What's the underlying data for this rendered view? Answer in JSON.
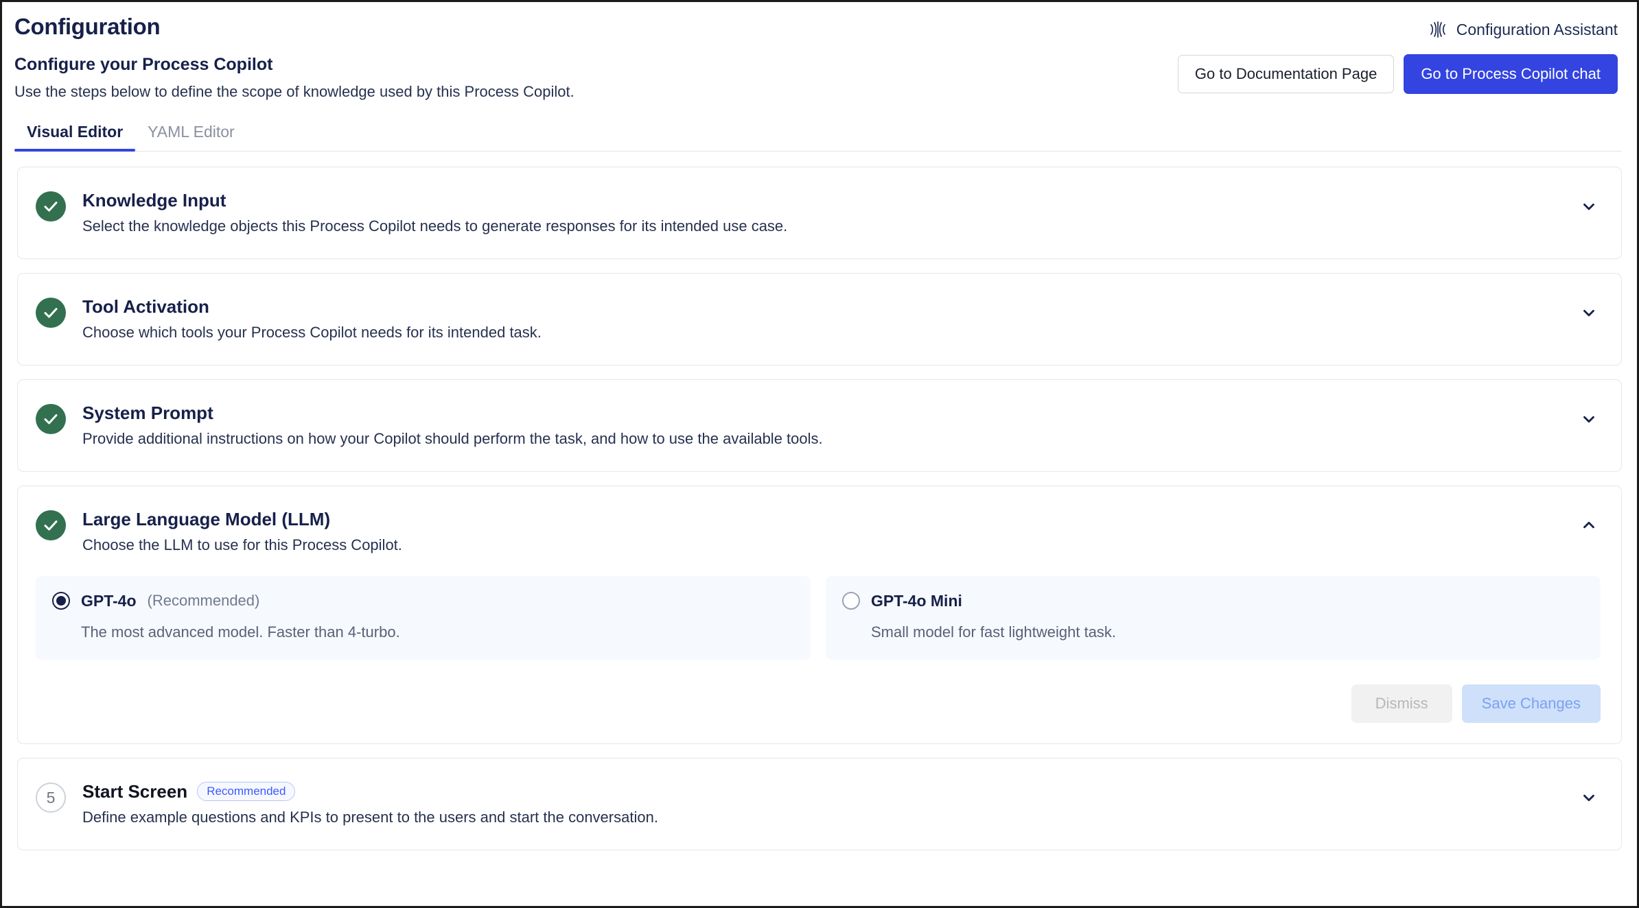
{
  "header": {
    "title": "Configuration",
    "assistant": {
      "label": "Configuration Assistant",
      "icon": "waveform-icon"
    }
  },
  "sub_header": {
    "title": "Configure your Process Copilot",
    "description": "Use the steps below to define the scope of knowledge used by this Process Copilot.",
    "actions": {
      "documentation_label": "Go to Documentation Page",
      "chat_label": "Go to Process Copilot chat"
    }
  },
  "tabs": [
    {
      "label": "Visual Editor",
      "active": true
    },
    {
      "label": "YAML Editor",
      "active": false
    }
  ],
  "steps": [
    {
      "marker": "check",
      "title": "Knowledge Input",
      "description": "Select the knowledge objects this Process Copilot needs to generate responses for its intended use case.",
      "expanded": false,
      "chevron": "chevron-down-icon"
    },
    {
      "marker": "check",
      "title": "Tool Activation",
      "description": "Choose which tools your Process Copilot needs for its intended task.",
      "expanded": false,
      "chevron": "chevron-down-icon"
    },
    {
      "marker": "check",
      "title": "System Prompt",
      "description": "Provide additional instructions on how your Copilot should perform the task, and how to use the available tools.",
      "expanded": false,
      "chevron": "chevron-down-icon"
    },
    {
      "marker": "check",
      "title": "Large Language Model (LLM)",
      "description": "Choose the LLM to use for this Process Copilot.",
      "expanded": true,
      "chevron": "chevron-up-icon"
    },
    {
      "marker": "5",
      "title": "Start Screen",
      "badge": "Recommended",
      "description": "Define example questions and KPIs to present to the users and start the conversation.",
      "expanded": false,
      "chevron": "chevron-down-icon"
    }
  ],
  "llm_panel": {
    "models": [
      {
        "name": "GPT-4o",
        "tag": "(Recommended)",
        "description": "The most advanced model. Faster than 4-turbo.",
        "selected": true
      },
      {
        "name": "GPT-4o Mini",
        "tag": "",
        "description": "Small model for fast lightweight task.",
        "selected": false
      }
    ],
    "dismiss_label": "Dismiss",
    "save_label": "Save Changes"
  },
  "colors": {
    "primary_blue": "#3344e0",
    "navy_text": "#17204a",
    "success_green": "#33704f",
    "badge_blue": "#3b5bfd",
    "save_disabled_bg": "#cfe0fb",
    "save_disabled_text": "#7ba2ee"
  }
}
